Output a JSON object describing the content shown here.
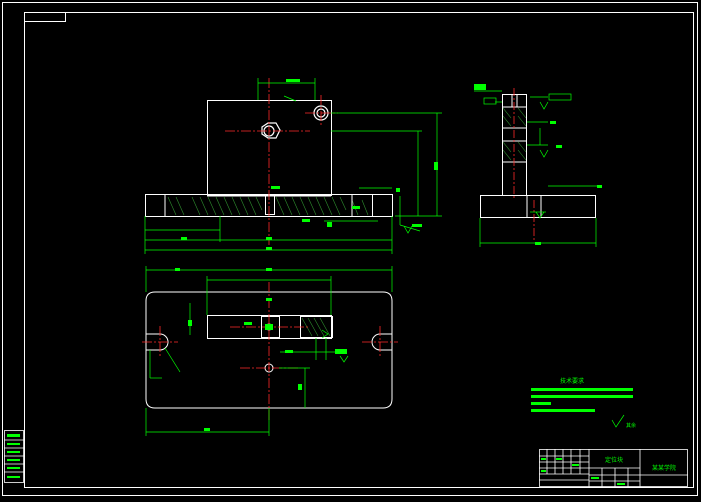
{
  "drawing": {
    "tech_req_title": "技术要求",
    "roughness_note": "其余",
    "title_block": {
      "part_name": "定位块",
      "company": "某某学院"
    }
  }
}
